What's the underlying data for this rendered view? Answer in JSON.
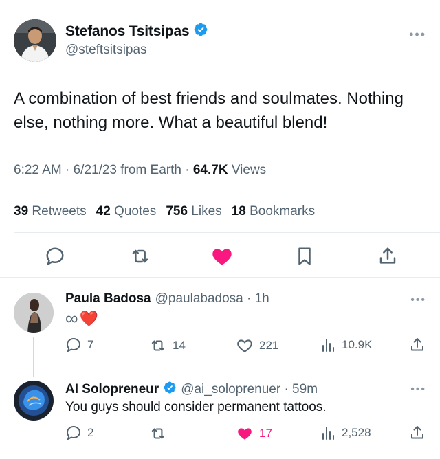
{
  "main_tweet": {
    "author_name": "Stefanos Tsitsipas",
    "handle": "@steftsitsipas",
    "more_label": "•••",
    "text": "A combination of best friends and soulmates. Nothing else, nothing more. What a beautiful blend!",
    "time": "6:22 AM · 6/21/23 from Earth · ",
    "views_count": "64.7K",
    "views_label": " Views",
    "stats": {
      "retweets_count": "39",
      "retweets_label": "Retweets",
      "quotes_count": "42",
      "quotes_label": "Quotes",
      "likes_count": "756",
      "likes_label": "Likes",
      "bookmarks_count": "18",
      "bookmarks_label": "Bookmarks"
    },
    "liked": true
  },
  "replies": [
    {
      "name": "Paula Badosa",
      "handle_time": "@paulabadosa · 1h",
      "verified": false,
      "text_symbol": "∞",
      "text_emoji": "❤️",
      "reply_count": "7",
      "retweet_count": "14",
      "like_count": "221",
      "views_count": "10.9K",
      "liked": false
    },
    {
      "name": "AI Solopreneur",
      "handle_time": "@ai_soloprenuer · 59m",
      "verified": true,
      "text": "You guys should consider permanent tattoos.",
      "reply_count": "2",
      "retweet_count": "",
      "like_count": "17",
      "views_count": "2,528",
      "liked": true
    }
  ],
  "colors": {
    "verified": "#1d9bf0",
    "like_active": "#f91880",
    "secondary_text": "#536471",
    "primary_text": "#0f1419"
  }
}
